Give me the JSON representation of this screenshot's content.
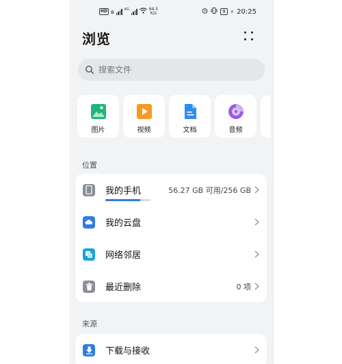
{
  "status_bar": {
    "network_type": "HD",
    "speed_value": "64.5",
    "speed_unit": "K/s",
    "battery": "9",
    "time": "20:25",
    "generation": "4G"
  },
  "header": {
    "title": "浏览"
  },
  "search": {
    "placeholder": "搜索文件"
  },
  "categories": [
    {
      "label": "图片",
      "icon": "image-icon",
      "color": "#1fb57a"
    },
    {
      "label": "视频",
      "icon": "video-icon",
      "color": "#f59a23"
    },
    {
      "label": "文档",
      "icon": "document-icon",
      "color": "#2f8cf0"
    },
    {
      "label": "音频",
      "icon": "audio-icon",
      "color": "#9b5ce0"
    }
  ],
  "locations": {
    "section_label": "位置",
    "items": [
      {
        "label": "我的手机",
        "value": "56.27 GB 可用/256 GB",
        "icon": "phone-icon",
        "usage_fraction": 0.78
      },
      {
        "label": "我的云盘",
        "value": "",
        "icon": "cloud-icon"
      },
      {
        "label": "网络邻居",
        "value": "",
        "icon": "network-icon"
      },
      {
        "label": "最近删除",
        "value": "0 项",
        "icon": "trash-icon"
      }
    ]
  },
  "sources": {
    "section_label": "来源",
    "items": [
      {
        "label": "下载与接收",
        "icon": "download-icon"
      }
    ]
  },
  "colors": {
    "accent": "#2f7de1",
    "background": "#f1f3f5",
    "card": "#ffffff"
  }
}
